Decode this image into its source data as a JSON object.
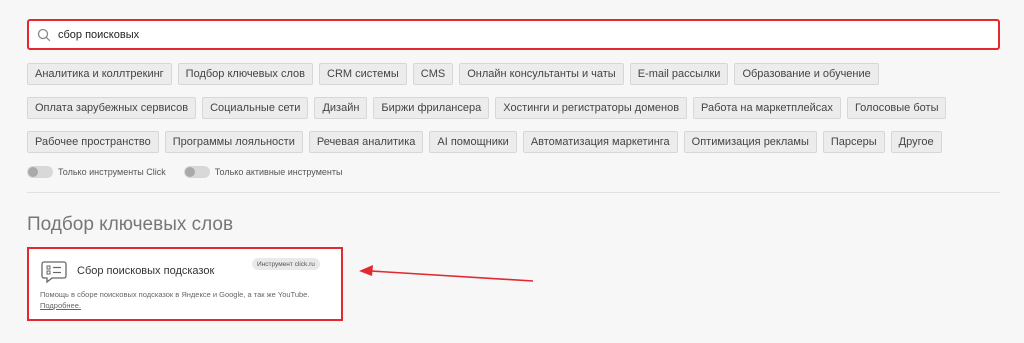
{
  "search": {
    "value": "сбор поисковых",
    "icon": "search-icon"
  },
  "tag_rows": [
    [
      "Аналитика и коллтрекинг",
      "Подбор ключевых слов",
      "CRM системы",
      "CMS",
      "Онлайн консультанты и чаты",
      "E-mail рассылки",
      "Образование и обучение"
    ],
    [
      "Оплата зарубежных сервисов",
      "Социальные сети",
      "Дизайн",
      "Биржи фрилансера",
      "Хостинги и регистраторы доменов",
      "Работа на маркетплейсах",
      "Голосовые боты"
    ],
    [
      "Рабочее пространство",
      "Программы лояльности",
      "Речевая аналитика",
      "AI помощники",
      "Автоматизация маркетинга",
      "Оптимизация рекламы",
      "Парсеры",
      "Другое"
    ]
  ],
  "toggles": [
    {
      "label": "Только инструменты Click",
      "on": false
    },
    {
      "label": "Только активные инструменты",
      "on": false
    }
  ],
  "section": {
    "title": "Подбор ключевых слов"
  },
  "card": {
    "title": "Сбор поисковых подсказок",
    "badge": "Инструмент click.ru",
    "desc": "Помощь в сборе поисковых подсказок в Яндексе и Google, а так же YouTube.",
    "link": "Подробнее.",
    "icon": "chat-list-icon"
  },
  "colors": {
    "highlight": "#e3282f",
    "background": "#f7f7f7",
    "tag_bg": "#ececec"
  }
}
